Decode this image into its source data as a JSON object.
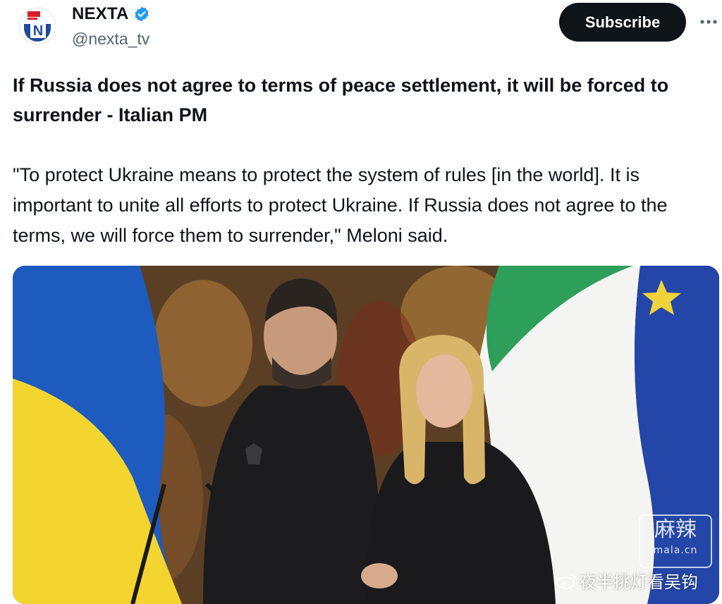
{
  "tweet": {
    "author": {
      "display_name": "NEXTA",
      "handle": "@nexta_tv",
      "verified": true,
      "avatar_icon": "nexta-logo-icon",
      "avatar_letter": "N"
    },
    "subscribe_label": "Subscribe",
    "more_icon": "ellipsis-icon",
    "headline": "If Russia does not agree to terms of peace settlement, it will be forced to surrender - Italian PM",
    "body": "\"To protect Ukraine means to protect the system of rules [in the world]. It is important to unite all efforts to protect Ukraine. If Russia does not agree to the terms, we will force them to surrender,\" Meloni said."
  },
  "media": {
    "type": "photo",
    "watermark_text": "夜半挑灯看吴钩",
    "watermark_logo_text": "麻辣",
    "watermark_logo_sub": "mala.cn"
  },
  "colors": {
    "text_primary": "#0f1419",
    "text_secondary": "#536471",
    "verified_blue": "#1d9bf0",
    "button_bg": "#0f1419",
    "nexta_red": "#d81e2c",
    "nexta_blue": "#1f4b9a",
    "ukraine_blue": "#1d5bbf",
    "ukraine_yellow": "#f4d530",
    "italy_green": "#2e9e5b",
    "italy_red": "#d83a3a",
    "eu_blue": "#2346a8"
  }
}
